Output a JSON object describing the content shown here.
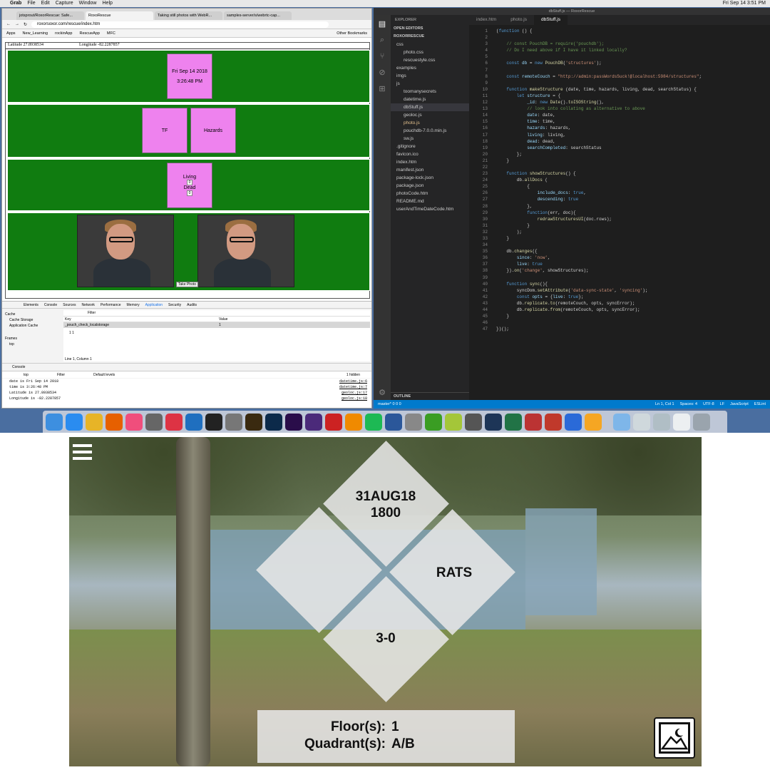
{
  "mac_menu": {
    "app": "Grab",
    "items": [
      "File",
      "Edit",
      "Capture",
      "Window",
      "Help"
    ],
    "clock": "Fri Sep 14  3:51 PM"
  },
  "browser": {
    "tabs": [
      "jotsprout/RoxorRescue: Safe...",
      "RoxoRescue",
      "Taking still photos with WebR...",
      "samples-server/s/webrtc-cap..."
    ],
    "url": "roxorsoxor.com/rescue/index.htm",
    "bookmarks": [
      "Apps",
      "New_Learning",
      "rockinApp",
      "RescueApp",
      "MFC",
      "Other Bookmarks"
    ],
    "latitude_label": "Latitude",
    "latitude": "27.8938534",
    "longitude_label": "Longitude",
    "longitude": "-82.2287857",
    "date": "Fri Sep 14 2018",
    "time": "3:26:48 PM",
    "tf": "TF",
    "hazards": "Hazards",
    "living": "Living",
    "dead": "Dead",
    "living_count": "0",
    "dead_count": "0",
    "take_photo": "Take Photo"
  },
  "devtools": {
    "tabs": [
      "Elements",
      "Console",
      "Sources",
      "Network",
      "Performance",
      "Memory",
      "Application",
      "Security",
      "Audits"
    ],
    "tree": [
      "Cache",
      "Cache Storage",
      "Application Cache",
      "Frames",
      "top"
    ],
    "filter": "Filter",
    "key_hdr": "Key",
    "value_hdr": "Value",
    "row_key": "_pouch_check_localstorage",
    "row_value": "1",
    "preview": "1  1",
    "cursor": "Line 1, Column 1",
    "console_tab": "Console",
    "context": "top",
    "levels": "Default levels",
    "hidden": "1 hidden",
    "logs": [
      {
        "text": "date is  Fri Sep 14 2018",
        "src": "datetime.js:6"
      },
      {
        "text": "time is  3:26:48 PM",
        "src": "datetime.js:7"
      },
      {
        "text": "Latitude is 27.8938534",
        "src": "geoloc.js:17"
      },
      {
        "text": "Longitude is -82.2287857",
        "src": "geoloc.js:18"
      }
    ]
  },
  "vscode": {
    "title": "dbStuff.js — RoxorRescue",
    "explorer": "EXPLORER",
    "open_editors": "OPEN EDITORS",
    "project": "ROXORRESCUE",
    "files": [
      "css",
      "photo.css",
      "rescuestyle.css",
      "examples",
      "imgs",
      "js",
      "toomanysecrets",
      "datetime.js",
      "dbStuff.js",
      "geoloc.js",
      "photo.js",
      "pouchdb-7.0.0.min.js",
      "sw.js",
      ".gitignore",
      "favicon.ico",
      "index.htm",
      "manifest.json",
      "package-lock.json",
      "package.json",
      "photoCode.htm",
      "README.md",
      "userAndTimeDateCode.htm"
    ],
    "outline": "OUTLINE",
    "tabs": [
      "index.htm",
      "photo.js",
      "dbStuff.js"
    ],
    "status_left": "master*   0 0  0",
    "status_right": [
      "Ln 1, Col 1",
      "Spaces: 4",
      "UTF-8",
      "LF",
      "JavaScript",
      "ESLint"
    ]
  },
  "app": {
    "date": "31AUG18",
    "time": "1800",
    "hazard": "RATS",
    "count": "3-0",
    "floor_label": "Floor(s):",
    "floor": "1",
    "quadrant_label": "Quadrant(s):",
    "quadrant": "A/B"
  },
  "icons": [
    "hamburger-menu-icon",
    "photo-gallery-icon"
  ]
}
